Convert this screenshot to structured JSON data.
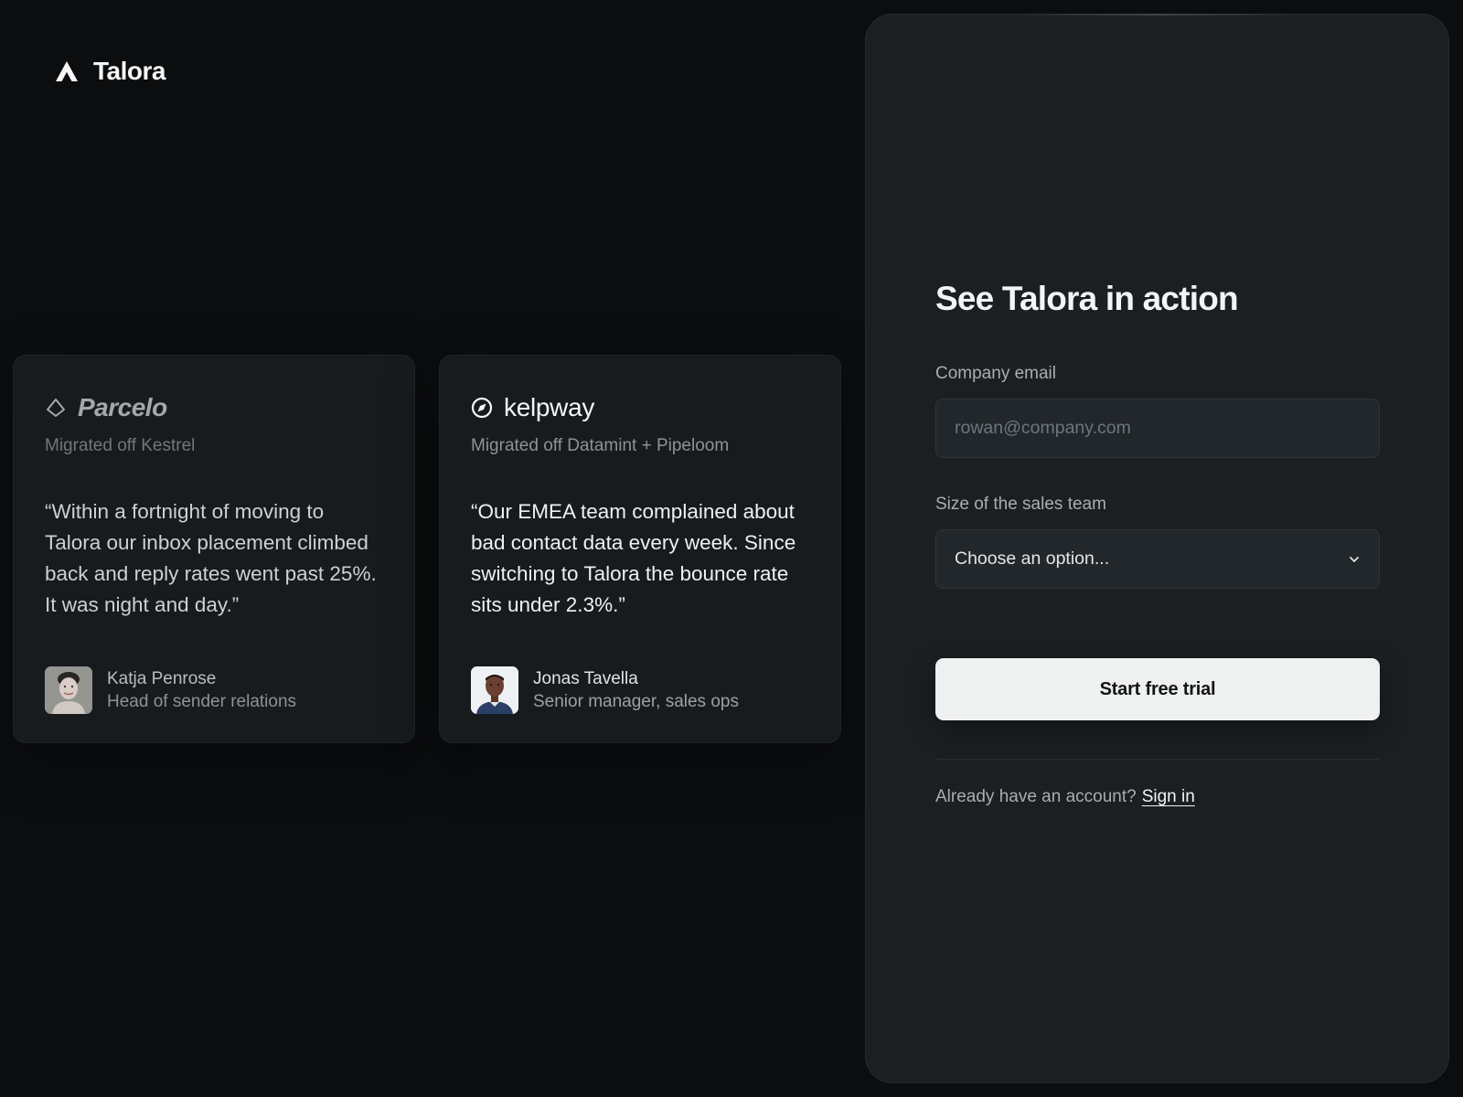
{
  "brand": {
    "name": "Talora",
    "icon": "triangle-logo-icon"
  },
  "testimonials": [
    {
      "company": "Parcelo",
      "company_icon": "diamond-outline-icon",
      "migrated": "Migrated off Kestrel",
      "quote": "“Within a fortnight of moving to Talora our inbox placement climbed back and reply rates went past 25%. It was night and day.”",
      "author_name": "Katja Penrose",
      "author_role": "Head of sender relations"
    },
    {
      "company": "kelpway",
      "company_icon": "compass-circle-icon",
      "migrated": "Migrated off Datamint + Pipeloom",
      "quote": "“Our EMEA team complained about bad contact data every week. Since switching to Talora the bounce rate sits under 2.3%.”",
      "author_name": "Jonas Tavella",
      "author_role": "Senior manager, sales ops"
    }
  ],
  "form": {
    "title": "See Talora in action",
    "email_label": "Company email",
    "email_placeholder": "rowan@company.com",
    "size_label": "Size of the sales team",
    "size_value": "Choose an option...",
    "cta_label": "Start free trial",
    "signin_prompt": "Already have an account?",
    "signin_link": "Sign in"
  },
  "colors": {
    "background": "#0b0d0f",
    "panel": "#1b1f22",
    "card": "#171b1e",
    "cta_bg": "#eff1f0"
  }
}
